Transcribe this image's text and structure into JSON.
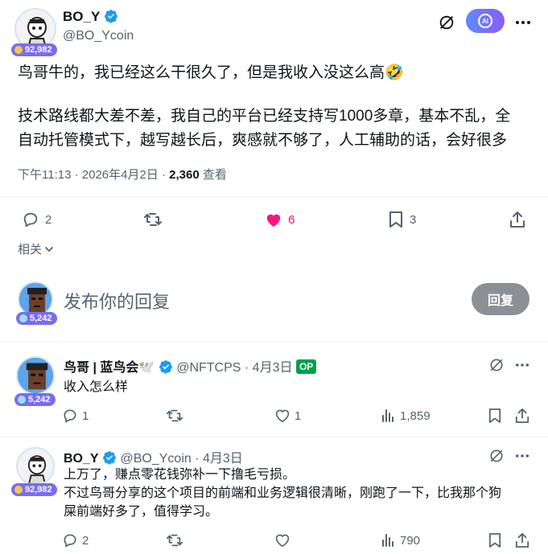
{
  "main_post": {
    "author_name": "BO_Y",
    "author_handle": "@BO_Ycoin",
    "badge": "92,982",
    "text_line1": "鸟哥牛的，我已经这么干很久了，但是我收入没这么高🤣",
    "text_line2": "技术路线都大差不差，我自己的平台已经支持写1000多章，基本不乱，全",
    "text_line3": "自动托管模式下，越写越长后，爽感就不够了，人工辅助的话，会好很多",
    "timestamp": "下午11:13 · 2026年4月2日 · ",
    "views": "2,360",
    "views_label": " 查看",
    "replies": "2",
    "likes": "6",
    "bookmarks": "3",
    "ai_label": "AI"
  },
  "related": {
    "label": "相关"
  },
  "composer": {
    "placeholder": "发布你的回复",
    "badge": "5,242",
    "reply_button": "回复"
  },
  "replies": [
    {
      "author_name": "鸟哥 | 蓝鸟会🕊️",
      "author_handle": "@NFTCPS",
      "date": " · 4月3日",
      "op_label": "OP",
      "badge": "5,242",
      "text": "收入怎么样",
      "replies": "1",
      "likes": "1",
      "views": "1,859"
    },
    {
      "author_name": "BO_Y",
      "author_handle": "@BO_Ycoin",
      "date": " · 4月3日",
      "badge": "92,982",
      "text_line1": "上万了，赚点零花钱弥补一下撸毛亏损。",
      "text_line2": "不过鸟哥分享的这个项目的前端和业务逻辑很清晰，刚跑了一下，比我那个狗",
      "text_line3": "屎前端好多了，值得学习。",
      "replies": "2",
      "likes": "",
      "views": "790"
    }
  ],
  "colors": {
    "accent": "#1d9bf0",
    "like": "#f91880",
    "badge": "#7a6cf0",
    "ai_button": "#6c63ff",
    "op": "#00a14b"
  }
}
